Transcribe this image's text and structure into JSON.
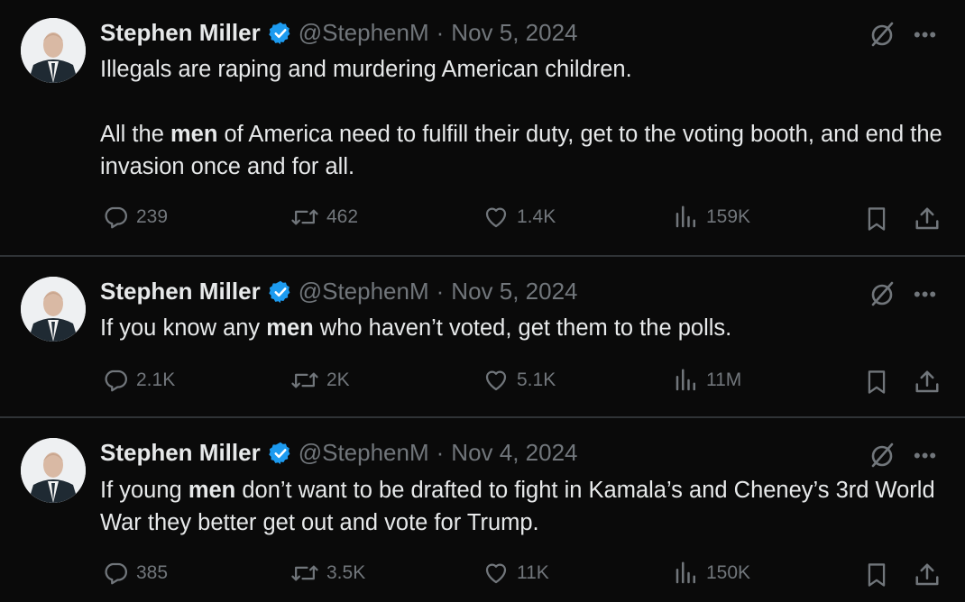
{
  "tweets": [
    {
      "name": "Stephen Miller",
      "handle": "@StephenM",
      "date": "Nov 5, 2024",
      "para1": {
        "a": "Illegals are raping and murdering American children.",
        "b": "",
        "c": ""
      },
      "para2": {
        "a": "All the ",
        "b": "men",
        "c": " of America need to fulfill their duty, get to the voting booth, and end the invasion once and for all."
      },
      "replies": "239",
      "reposts": "462",
      "likes": "1.4K",
      "views": "159K"
    },
    {
      "name": "Stephen Miller",
      "handle": "@StephenM",
      "date": "Nov 5, 2024",
      "para1": {
        "a": "If you know any ",
        "b": "men",
        "c": " who haven’t voted, get them to the polls."
      },
      "replies": "2.1K",
      "reposts": "2K",
      "likes": "5.1K",
      "views": "11M"
    },
    {
      "name": "Stephen Miller",
      "handle": "@StephenM",
      "date": "Nov 4, 2024",
      "para1": {
        "a": "If young ",
        "b": "men",
        "c": " don’t want to be drafted to fight in Kamala’s and Cheney’s 3rd World War they better get out and vote for Trump."
      },
      "replies": "385",
      "reposts": "3.5K",
      "likes": "11K",
      "views": "150K"
    }
  ],
  "separator": "·",
  "more_label": "•••",
  "icons": [
    "verified-badge-icon",
    "grok-icon",
    "more-icon",
    "reply-icon",
    "repost-icon",
    "like-icon",
    "views-icon",
    "bookmark-icon",
    "share-icon"
  ],
  "colors": {
    "background": "#0a0a0a",
    "text": "#e7e9ea",
    "muted": "#71767b",
    "verified": "#1d9bf0",
    "divider": "#2f3336"
  }
}
